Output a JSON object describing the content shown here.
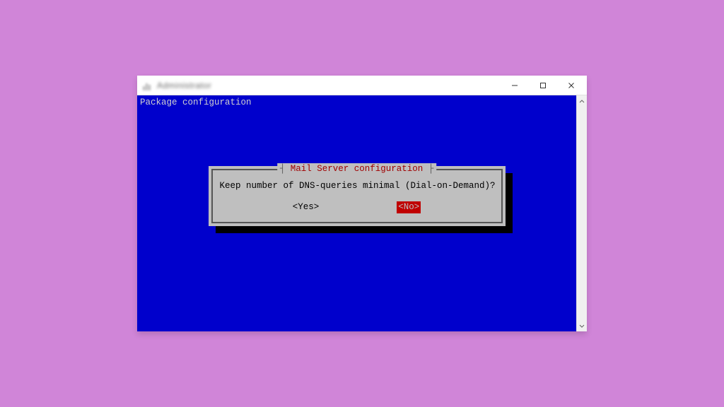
{
  "window": {
    "title": "Administrator"
  },
  "terminal": {
    "header": "Package configuration"
  },
  "dialog": {
    "title": "Mail Server configuration",
    "question": "Keep number of DNS-queries minimal (Dial-on-Demand)?",
    "yes_label": "<Yes>",
    "no_label": "<No>"
  }
}
